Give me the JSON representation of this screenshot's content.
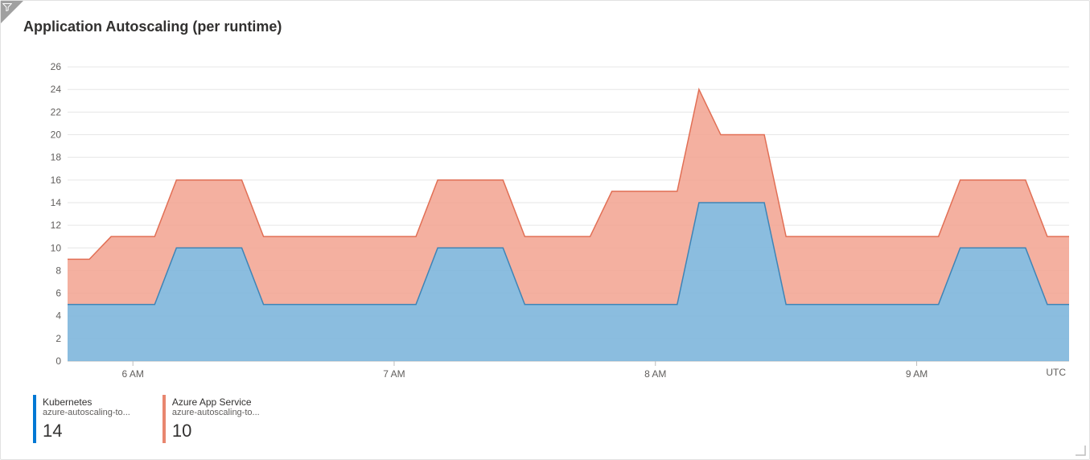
{
  "title": "Application Autoscaling (per runtime)",
  "timezone_label": "UTC",
  "colors": {
    "kubernetes_fill": "#7eb6dc",
    "kubernetes_line": "#3e84b6",
    "azure_fill": "#f2a28f",
    "azure_line": "#e16f55",
    "legend_k": "#0078d4",
    "legend_a": "#e8866f"
  },
  "legend": [
    {
      "name": "Kubernetes",
      "sub": "azure-autoscaling-to...",
      "value": "14",
      "color_key": "legend_k"
    },
    {
      "name": "Azure App Service",
      "sub": "azure-autoscaling-to...",
      "value": "10",
      "color_key": "legend_a"
    }
  ],
  "chart_data": {
    "type": "area",
    "stacked": true,
    "title": "Application Autoscaling (per runtime)",
    "xlabel": "",
    "ylabel": "",
    "ylim": [
      0,
      27
    ],
    "y_ticks": [
      0,
      2,
      4,
      6,
      8,
      10,
      12,
      14,
      16,
      18,
      20,
      22,
      24,
      26
    ],
    "x_tick_labels": [
      "6 AM",
      "7 AM",
      "8 AM",
      "9 AM"
    ],
    "x_tick_positions": [
      3,
      15,
      27,
      39
    ],
    "series": [
      {
        "name": "Kubernetes",
        "values": [
          5,
          5,
          5,
          5,
          5,
          10,
          10,
          10,
          10,
          5,
          5,
          5,
          5,
          5,
          5,
          5,
          5,
          10,
          10,
          10,
          10,
          5,
          5,
          5,
          5,
          5,
          5,
          5,
          5,
          14,
          14,
          14,
          14,
          5,
          5,
          5,
          5,
          5,
          5,
          5,
          5,
          10,
          10,
          10,
          10,
          5,
          5
        ]
      },
      {
        "name": "Azure App Service",
        "values": [
          4,
          4,
          6,
          6,
          6,
          6,
          6,
          6,
          6,
          6,
          6,
          6,
          6,
          6,
          6,
          6,
          6,
          6,
          6,
          6,
          6,
          6,
          6,
          6,
          6,
          10,
          10,
          10,
          10,
          10,
          6,
          6,
          7,
          6,
          6,
          6,
          6,
          6,
          6,
          6,
          6,
          6,
          6,
          6,
          6,
          6,
          6
        ]
      }
    ],
    "stacked_top_values": [
      9,
      9,
      11,
      11,
      11,
      16,
      16,
      16,
      16,
      11,
      11,
      11,
      11,
      11,
      11,
      11,
      11,
      16,
      16,
      16,
      16,
      11,
      11,
      11,
      11,
      15,
      15,
      15,
      15,
      24,
      20,
      20,
      20,
      11,
      11,
      11,
      11,
      11,
      11,
      11,
      11,
      16,
      16,
      16,
      16,
      11,
      11
    ]
  }
}
